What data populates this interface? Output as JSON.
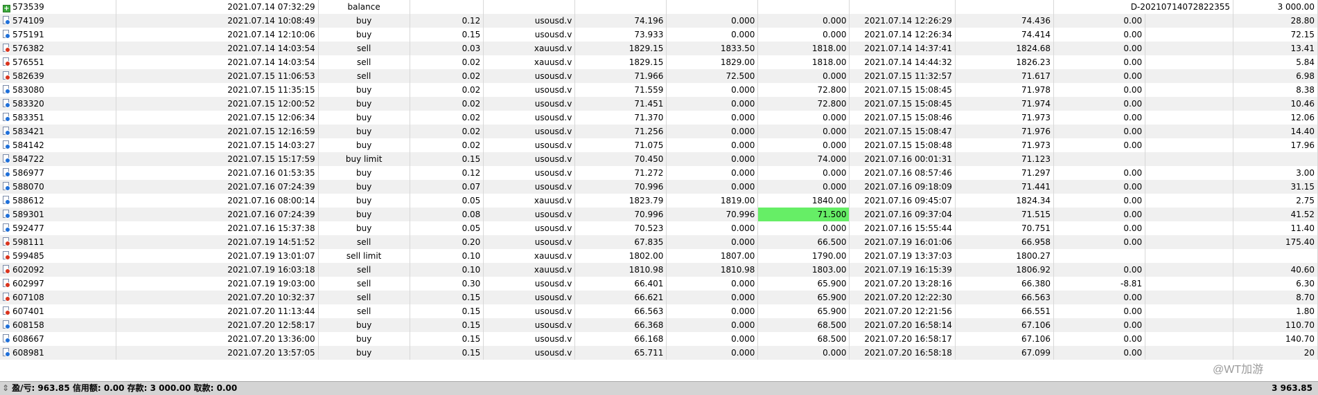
{
  "balance_row": {
    "ticket": "573539",
    "time": "2021.07.14 07:32:29",
    "type": "balance",
    "comment": "D-20210714072822355",
    "amount": "3 000.00"
  },
  "trades": [
    {
      "ticket": "574109",
      "open_time": "2021.07.14 10:08:49",
      "type": "buy",
      "size": "0.12",
      "symbol": "usousd.v",
      "price": "74.196",
      "sl": "0.000",
      "tp": "0.000",
      "close_time": "2021.07.14 12:26:29",
      "close_price": "74.436",
      "swap": "0.00",
      "profit": "28.80",
      "dir": "buy"
    },
    {
      "ticket": "575191",
      "open_time": "2021.07.14 12:10:06",
      "type": "buy",
      "size": "0.15",
      "symbol": "usousd.v",
      "price": "73.933",
      "sl": "0.000",
      "tp": "0.000",
      "close_time": "2021.07.14 12:26:34",
      "close_price": "74.414",
      "swap": "0.00",
      "profit": "72.15",
      "dir": "buy"
    },
    {
      "ticket": "576382",
      "open_time": "2021.07.14 14:03:54",
      "type": "sell",
      "size": "0.03",
      "symbol": "xauusd.v",
      "price": "1829.15",
      "sl": "1833.50",
      "tp": "1818.00",
      "close_time": "2021.07.14 14:37:41",
      "close_price": "1824.68",
      "swap": "0.00",
      "profit": "13.41",
      "dir": "sell"
    },
    {
      "ticket": "576551",
      "open_time": "2021.07.14 14:03:54",
      "type": "sell",
      "size": "0.02",
      "symbol": "xauusd.v",
      "price": "1829.15",
      "sl": "1829.00",
      "tp": "1818.00",
      "close_time": "2021.07.14 14:44:32",
      "close_price": "1826.23",
      "swap": "0.00",
      "profit": "5.84",
      "dir": "sell"
    },
    {
      "ticket": "582639",
      "open_time": "2021.07.15 11:06:53",
      "type": "sell",
      "size": "0.02",
      "symbol": "usousd.v",
      "price": "71.966",
      "sl": "72.500",
      "tp": "0.000",
      "close_time": "2021.07.15 11:32:57",
      "close_price": "71.617",
      "swap": "0.00",
      "profit": "6.98",
      "dir": "sell"
    },
    {
      "ticket": "583080",
      "open_time": "2021.07.15 11:35:15",
      "type": "buy",
      "size": "0.02",
      "symbol": "usousd.v",
      "price": "71.559",
      "sl": "0.000",
      "tp": "72.800",
      "close_time": "2021.07.15 15:08:45",
      "close_price": "71.978",
      "swap": "0.00",
      "profit": "8.38",
      "dir": "buy"
    },
    {
      "ticket": "583320",
      "open_time": "2021.07.15 12:00:52",
      "type": "buy",
      "size": "0.02",
      "symbol": "usousd.v",
      "price": "71.451",
      "sl": "0.000",
      "tp": "72.800",
      "close_time": "2021.07.15 15:08:45",
      "close_price": "71.974",
      "swap": "0.00",
      "profit": "10.46",
      "dir": "buy"
    },
    {
      "ticket": "583351",
      "open_time": "2021.07.15 12:06:34",
      "type": "buy",
      "size": "0.02",
      "symbol": "usousd.v",
      "price": "71.370",
      "sl": "0.000",
      "tp": "0.000",
      "close_time": "2021.07.15 15:08:46",
      "close_price": "71.973",
      "swap": "0.00",
      "profit": "12.06",
      "dir": "buy"
    },
    {
      "ticket": "583421",
      "open_time": "2021.07.15 12:16:59",
      "type": "buy",
      "size": "0.02",
      "symbol": "usousd.v",
      "price": "71.256",
      "sl": "0.000",
      "tp": "0.000",
      "close_time": "2021.07.15 15:08:47",
      "close_price": "71.976",
      "swap": "0.00",
      "profit": "14.40",
      "dir": "buy"
    },
    {
      "ticket": "584142",
      "open_time": "2021.07.15 14:03:27",
      "type": "buy",
      "size": "0.02",
      "symbol": "usousd.v",
      "price": "71.075",
      "sl": "0.000",
      "tp": "0.000",
      "close_time": "2021.07.15 15:08:48",
      "close_price": "71.973",
      "swap": "0.00",
      "profit": "17.96",
      "dir": "buy"
    },
    {
      "ticket": "584722",
      "open_time": "2021.07.15 15:17:59",
      "type": "buy limit",
      "size": "0.15",
      "symbol": "usousd.v",
      "price": "70.450",
      "sl": "0.000",
      "tp": "74.000",
      "close_time": "2021.07.16 00:01:31",
      "close_price": "71.123",
      "swap": "",
      "profit": "",
      "dir": "buy"
    },
    {
      "ticket": "586977",
      "open_time": "2021.07.16 01:53:35",
      "type": "buy",
      "size": "0.12",
      "symbol": "usousd.v",
      "price": "71.272",
      "sl": "0.000",
      "tp": "0.000",
      "close_time": "2021.07.16 08:57:46",
      "close_price": "71.297",
      "swap": "0.00",
      "profit": "3.00",
      "dir": "buy"
    },
    {
      "ticket": "588070",
      "open_time": "2021.07.16 07:24:39",
      "type": "buy",
      "size": "0.07",
      "symbol": "usousd.v",
      "price": "70.996",
      "sl": "0.000",
      "tp": "0.000",
      "close_time": "2021.07.16 09:18:09",
      "close_price": "71.441",
      "swap": "0.00",
      "profit": "31.15",
      "dir": "buy"
    },
    {
      "ticket": "588612",
      "open_time": "2021.07.16 08:00:14",
      "type": "buy",
      "size": "0.05",
      "symbol": "xauusd.v",
      "price": "1823.79",
      "sl": "1819.00",
      "tp": "1840.00",
      "close_time": "2021.07.16 09:45:07",
      "close_price": "1824.34",
      "swap": "0.00",
      "profit": "2.75",
      "dir": "buy"
    },
    {
      "ticket": "589301",
      "open_time": "2021.07.16 07:24:39",
      "type": "buy",
      "size": "0.08",
      "symbol": "usousd.v",
      "price": "70.996",
      "sl": "70.996",
      "tp": "71.500",
      "close_time": "2021.07.16 09:37:04",
      "close_price": "71.515",
      "swap": "0.00",
      "profit": "41.52",
      "dir": "buy",
      "tp_highlight": true
    },
    {
      "ticket": "592477",
      "open_time": "2021.07.16 15:37:38",
      "type": "buy",
      "size": "0.05",
      "symbol": "usousd.v",
      "price": "70.523",
      "sl": "0.000",
      "tp": "0.000",
      "close_time": "2021.07.16 15:55:44",
      "close_price": "70.751",
      "swap": "0.00",
      "profit": "11.40",
      "dir": "buy"
    },
    {
      "ticket": "598111",
      "open_time": "2021.07.19 14:51:52",
      "type": "sell",
      "size": "0.20",
      "symbol": "usousd.v",
      "price": "67.835",
      "sl": "0.000",
      "tp": "66.500",
      "close_time": "2021.07.19 16:01:06",
      "close_price": "66.958",
      "swap": "0.00",
      "profit": "175.40",
      "dir": "sell"
    },
    {
      "ticket": "599485",
      "open_time": "2021.07.19 13:01:07",
      "type": "sell limit",
      "size": "0.10",
      "symbol": "xauusd.v",
      "price": "1802.00",
      "sl": "1807.00",
      "tp": "1790.00",
      "close_time": "2021.07.19 13:37:03",
      "close_price": "1800.27",
      "swap": "",
      "profit": "",
      "dir": "sell"
    },
    {
      "ticket": "602092",
      "open_time": "2021.07.19 16:03:18",
      "type": "sell",
      "size": "0.10",
      "symbol": "xauusd.v",
      "price": "1810.98",
      "sl": "1810.98",
      "tp": "1803.00",
      "close_time": "2021.07.19 16:15:39",
      "close_price": "1806.92",
      "swap": "0.00",
      "profit": "40.60",
      "dir": "sell"
    },
    {
      "ticket": "602997",
      "open_time": "2021.07.19 19:03:00",
      "type": "sell",
      "size": "0.30",
      "symbol": "usousd.v",
      "price": "66.401",
      "sl": "0.000",
      "tp": "65.900",
      "close_time": "2021.07.20 13:28:16",
      "close_price": "66.380",
      "swap": "-8.81",
      "profit": "6.30",
      "dir": "sell"
    },
    {
      "ticket": "607108",
      "open_time": "2021.07.20 10:32:37",
      "type": "sell",
      "size": "0.15",
      "symbol": "usousd.v",
      "price": "66.621",
      "sl": "0.000",
      "tp": "65.900",
      "close_time": "2021.07.20 12:22:30",
      "close_price": "66.563",
      "swap": "0.00",
      "profit": "8.70",
      "dir": "sell"
    },
    {
      "ticket": "607401",
      "open_time": "2021.07.20 11:13:44",
      "type": "sell",
      "size": "0.15",
      "symbol": "usousd.v",
      "price": "66.563",
      "sl": "0.000",
      "tp": "65.900",
      "close_time": "2021.07.20 12:21:56",
      "close_price": "66.551",
      "swap": "0.00",
      "profit": "1.80",
      "dir": "sell"
    },
    {
      "ticket": "608158",
      "open_time": "2021.07.20 12:58:17",
      "type": "buy",
      "size": "0.15",
      "symbol": "usousd.v",
      "price": "66.368",
      "sl": "0.000",
      "tp": "68.500",
      "close_time": "2021.07.20 16:58:14",
      "close_price": "67.106",
      "swap": "0.00",
      "profit": "110.70",
      "dir": "buy"
    },
    {
      "ticket": "608667",
      "open_time": "2021.07.20 13:36:00",
      "type": "buy",
      "size": "0.15",
      "symbol": "usousd.v",
      "price": "66.168",
      "sl": "0.000",
      "tp": "68.500",
      "close_time": "2021.07.20 16:58:17",
      "close_price": "67.106",
      "swap": "0.00",
      "profit": "140.70",
      "dir": "buy"
    },
    {
      "ticket": "608981",
      "open_time": "2021.07.20 13:57:05",
      "type": "buy",
      "size": "0.15",
      "symbol": "usousd.v",
      "price": "65.711",
      "sl": "0.000",
      "tp": "0.000",
      "close_time": "2021.07.20 16:58:18",
      "close_price": "67.099",
      "swap": "0.00",
      "profit": "20",
      "dir": "buy"
    }
  ],
  "summary": {
    "sort_glyph": "⇕",
    "text": "盈/亏: 963.85  信用额: 0.00  存款: 3 000.00  取款: 0.00",
    "total": "3 963.85"
  },
  "watermark": "@WT加游",
  "colors": {
    "row_alt": "#f0f0f0",
    "tp_highlight": "#66ee66",
    "summary_bar": "#d4d4d4"
  }
}
